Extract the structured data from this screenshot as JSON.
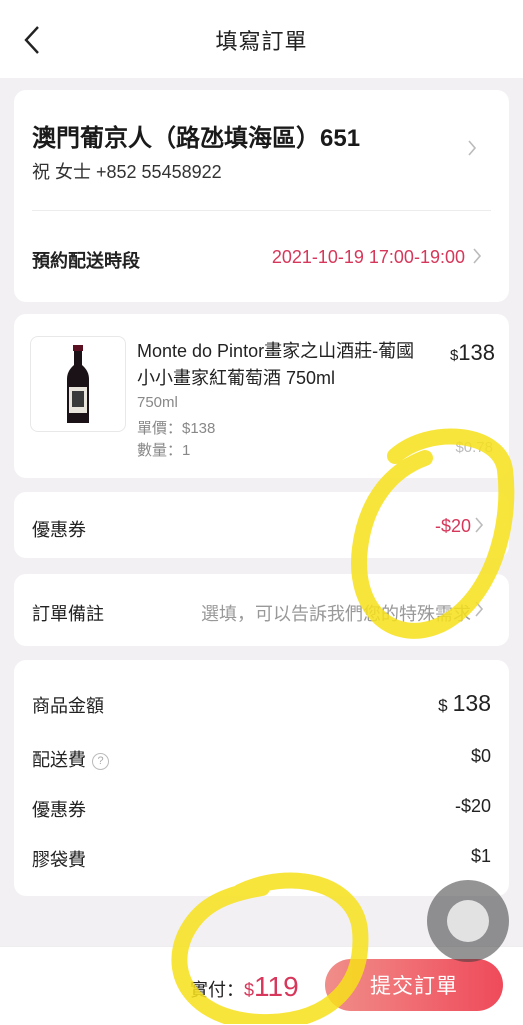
{
  "header": {
    "title": "填寫訂單"
  },
  "address": {
    "location": "澳門葡京人（路氹填海區）651",
    "contact": "祝  女士   +852 55458922"
  },
  "delivery": {
    "label": "預約配送時段",
    "value": "2021-10-19 17:00-19:00"
  },
  "product": {
    "name": "Monte do Pintor畫家之山酒莊-葡國 小小畫家紅葡萄酒 750ml",
    "spec": "750ml",
    "unit_price": "單價：$138",
    "quantity": "數量：1",
    "price_currency": "$",
    "price_amount": "138",
    "subtotal_partial": "$0.78"
  },
  "coupon": {
    "label": "優惠券",
    "value": "-$20"
  },
  "remark": {
    "label": "訂單備註",
    "placeholder": "選填，可以告訴我們您的特殊需求"
  },
  "summary": {
    "goods_label": "商品金額",
    "goods_currency": "$",
    "goods_amount": "138",
    "shipping_label": "配送費",
    "shipping_help": "?",
    "shipping_value": "$0",
    "coupon_label": "優惠券",
    "coupon_value": "-$20",
    "bag_label": "膠袋費",
    "bag_value": "$1"
  },
  "footer": {
    "pay_label": "實付：",
    "pay_currency": "$",
    "pay_amount": "119",
    "submit_label": "提交訂單"
  },
  "colors": {
    "accent": "#d6375a",
    "highlighter": "#f7e01a",
    "background": "#f2f0f3"
  }
}
